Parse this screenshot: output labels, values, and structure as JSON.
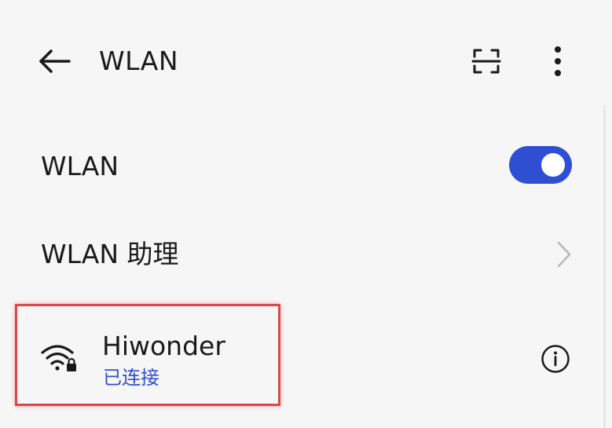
{
  "header": {
    "title": "WLAN",
    "back_icon": "arrow-left-icon",
    "scan_icon": "scan-icon",
    "more_icon": "more-vertical-icon"
  },
  "settings": {
    "wlan_label": "WLAN",
    "wlan_enabled": true,
    "assistant_label": "WLAN 助理"
  },
  "network": {
    "name": "Hiwonder",
    "status": "已连接",
    "signal_icon": "wifi-lock-icon",
    "info_icon": "info-icon"
  },
  "colors": {
    "accent": "#2f4fd3",
    "background": "#f6f6f6",
    "highlight": "#d9494b"
  }
}
